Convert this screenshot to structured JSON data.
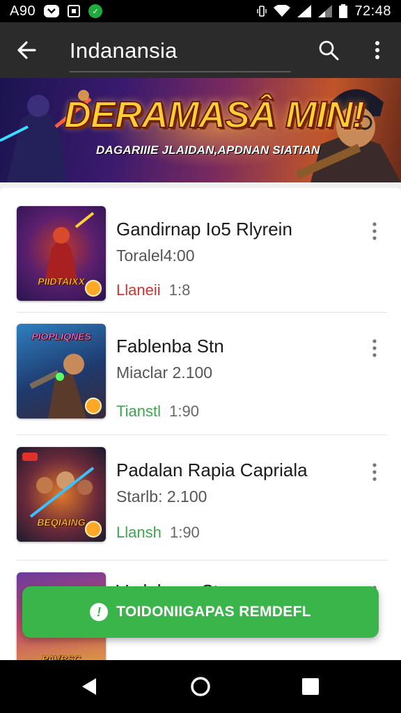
{
  "status_bar": {
    "carrier": "A90",
    "time": "72:48"
  },
  "app_bar": {
    "title": "Indanansia",
    "back_icon": "arrow-back-icon",
    "search_icon": "search-icon",
    "more_icon": "more-vert-icon"
  },
  "banner": {
    "title": "DERAMASÂ MIN!",
    "subtitle": "DAGARIIIE JLAIDAN,APDNAN SIATIAN"
  },
  "list": {
    "items": [
      {
        "title": "Gandirnap Io5 Rlyrein",
        "meta": "Toralel4:00",
        "status_label": "Llaneii",
        "status_value": "1:8",
        "status_color": "#d32f2f",
        "thumb_label": "PIIDTAIXX",
        "thumb_colors": [
          "#3a1f6e",
          "#c0392b",
          "#f0a030"
        ]
      },
      {
        "title": "Fablenba Stn",
        "meta": "Miaclar 2.100",
        "status_label": "Tianstl",
        "status_value": "1:90",
        "status_color": "#3aa84a",
        "thumb_label": "PIOPLIQNES",
        "thumb_colors": [
          "#1e3a6e",
          "#2f7fbf",
          "#8a4a2a"
        ]
      },
      {
        "title": "Padalan Rapia Capriala",
        "meta": "Starlb: 2.100",
        "status_label": "Llansh",
        "status_value": "1:90",
        "status_color": "#3aa84a",
        "thumb_label": "BEQIAING",
        "thumb_colors": [
          "#2a1a3e",
          "#c05a1a",
          "#2a8acf"
        ]
      },
      {
        "title": "Varlalame Sto",
        "meta": "",
        "status_label": "",
        "status_value": "",
        "status_color": "#3aa84a",
        "thumb_label": "PAVBSC",
        "thumb_colors": [
          "#3a2a6e",
          "#c04a6a",
          "#e0a040"
        ]
      }
    ]
  },
  "snackbar": {
    "label": "TOIDONIIGAPAS REMDEFL",
    "icon": "alert-icon"
  },
  "nav_bar": {
    "back_icon": "nav-back-icon",
    "home_icon": "nav-home-icon",
    "recents_icon": "nav-recents-icon"
  }
}
